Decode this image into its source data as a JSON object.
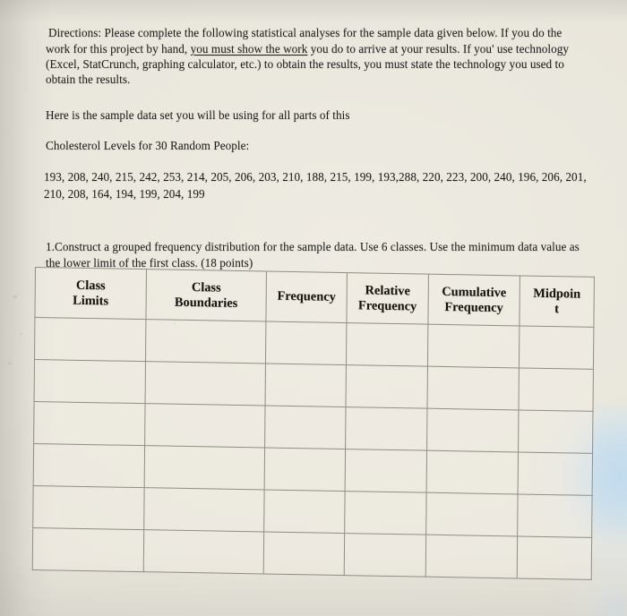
{
  "document": {
    "type": "worksheet-photo",
    "paper_color": "#e9e6dd",
    "ink_color": "#22201d",
    "rule_color": "#8f8d84",
    "glare_color": "#bcd9ee"
  },
  "directions": {
    "label": "Directions:",
    "text_before_underline": "Directions: Please complete the following statistical analyses for the sample data given below. If you do the work for this project by hand, ",
    "underlined_text": "you must show the work",
    "text_after_underline": " you do to arrive at your results. If you' use technology (Excel, StatCrunch, graphing calculator, etc.) to obtain the results, you must state the technology you used to obtain the results."
  },
  "intro": {
    "here_line": "Here is the sample data set you will be using for all parts of this",
    "dataset_title": "Cholesterol Levels for 30 Random People:",
    "data_values_line": "193, 208, 240, 215, 242, 253, 214, 205, 206, 203, 210, 188, 215, 199, 193,288, 220, 223, 200, 240, 196, 206, 201, 210, 208, 164, 194, 199, 204, 199"
  },
  "question1": {
    "number": "1.",
    "text": "Construct a grouped frequency distribution for the sample data.  Use 6 classes. Use the minimum data value as the lower limit of the first class. (18 points)"
  },
  "table": {
    "headers": [
      "Class Limits",
      "Class Boundaries",
      "Frequency",
      "Relative Frequency",
      "Cumulative Frequency",
      "Midpoint"
    ],
    "header_lines": [
      [
        "Class",
        "Limits"
      ],
      [
        "Class",
        "Boundaries"
      ],
      [
        "Frequency",
        ""
      ],
      [
        "Relative",
        "Frequency"
      ],
      [
        "Cumulative",
        "Frequency"
      ],
      [
        "Midpoin",
        "t"
      ]
    ],
    "row_count": 6,
    "column_count": 6,
    "rows": [
      [
        "",
        "",
        "",
        "",
        "",
        ""
      ],
      [
        "",
        "",
        "",
        "",
        "",
        ""
      ],
      [
        "",
        "",
        "",
        "",
        "",
        ""
      ],
      [
        "",
        "",
        "",
        "",
        "",
        ""
      ],
      [
        "",
        "",
        "",
        "",
        "",
        ""
      ],
      [
        "",
        "",
        "",
        "",
        "",
        ""
      ]
    ]
  }
}
